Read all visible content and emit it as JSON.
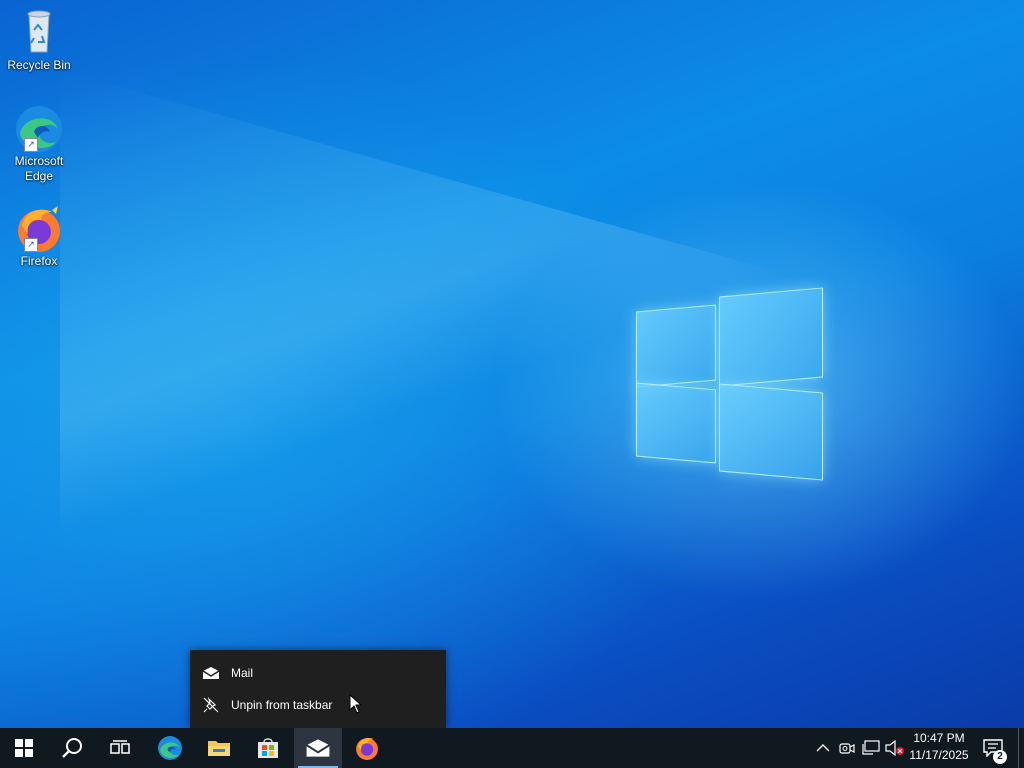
{
  "desktop": {
    "icons": [
      {
        "label": "Recycle Bin",
        "icon": "recycle-bin-icon"
      },
      {
        "label": "Microsoft Edge",
        "icon": "edge-icon"
      },
      {
        "label": "Firefox",
        "icon": "firefox-icon"
      }
    ]
  },
  "context_menu": {
    "items": [
      {
        "label": "Mail",
        "icon": "mail-icon"
      },
      {
        "label": "Unpin from taskbar",
        "icon": "unpin-icon"
      }
    ]
  },
  "taskbar": {
    "buttons": [
      {
        "name": "Start",
        "icon": "windows-start-icon"
      },
      {
        "name": "Search",
        "icon": "search-icon"
      },
      {
        "name": "Task View",
        "icon": "task-view-icon"
      },
      {
        "name": "Microsoft Edge",
        "icon": "edge-icon"
      },
      {
        "name": "File Explorer",
        "icon": "folder-icon"
      },
      {
        "name": "Microsoft Store",
        "icon": "store-icon"
      },
      {
        "name": "Mail",
        "icon": "mail-icon"
      },
      {
        "name": "Firefox",
        "icon": "firefox-icon"
      }
    ],
    "tray": {
      "icons": [
        "chevron-up-icon",
        "meet-now-icon",
        "network-icon",
        "volume-muted-icon"
      ],
      "time": "10:47 PM",
      "date": "11/17/2025",
      "notification_count": "2"
    }
  },
  "colors": {
    "taskbar_bg": "#101820",
    "menu_bg": "#1f1f1f",
    "accent": "#0b7fe0"
  }
}
